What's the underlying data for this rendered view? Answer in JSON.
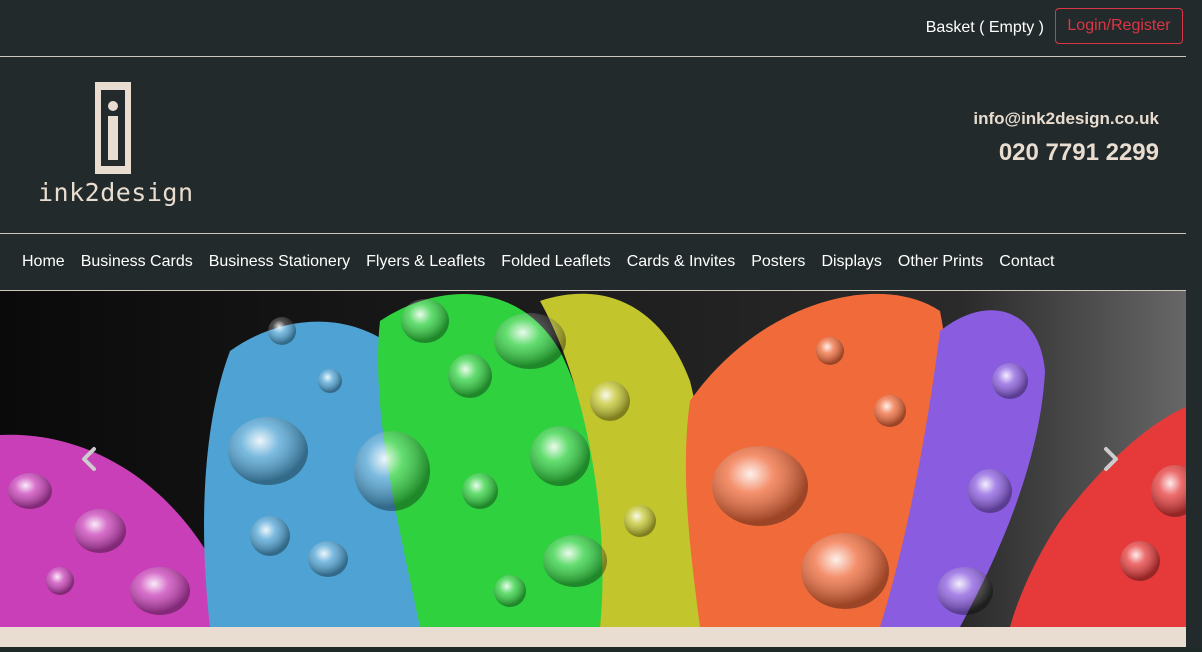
{
  "topbar": {
    "basket_label": "Basket ( Empty )",
    "login_label": "Login/Register"
  },
  "header": {
    "logo_text": "ink2design",
    "email": "info@ink2design.co.uk",
    "phone": "020 7791 2299"
  },
  "nav": {
    "items": [
      {
        "label": "Home"
      },
      {
        "label": "Business Cards"
      },
      {
        "label": "Business Stationery"
      },
      {
        "label": "Flyers & Leaflets"
      },
      {
        "label": "Folded Leaflets"
      },
      {
        "label": "Cards & Invites"
      },
      {
        "label": "Posters"
      },
      {
        "label": "Displays"
      },
      {
        "label": "Other Prints"
      },
      {
        "label": "Contact"
      }
    ]
  },
  "carousel": {
    "prev_icon": "chevron-left-icon",
    "next_icon": "chevron-right-icon"
  },
  "colors": {
    "background": "#232a2b",
    "accent": "#dc3545",
    "beige": "#e8ddd0"
  }
}
